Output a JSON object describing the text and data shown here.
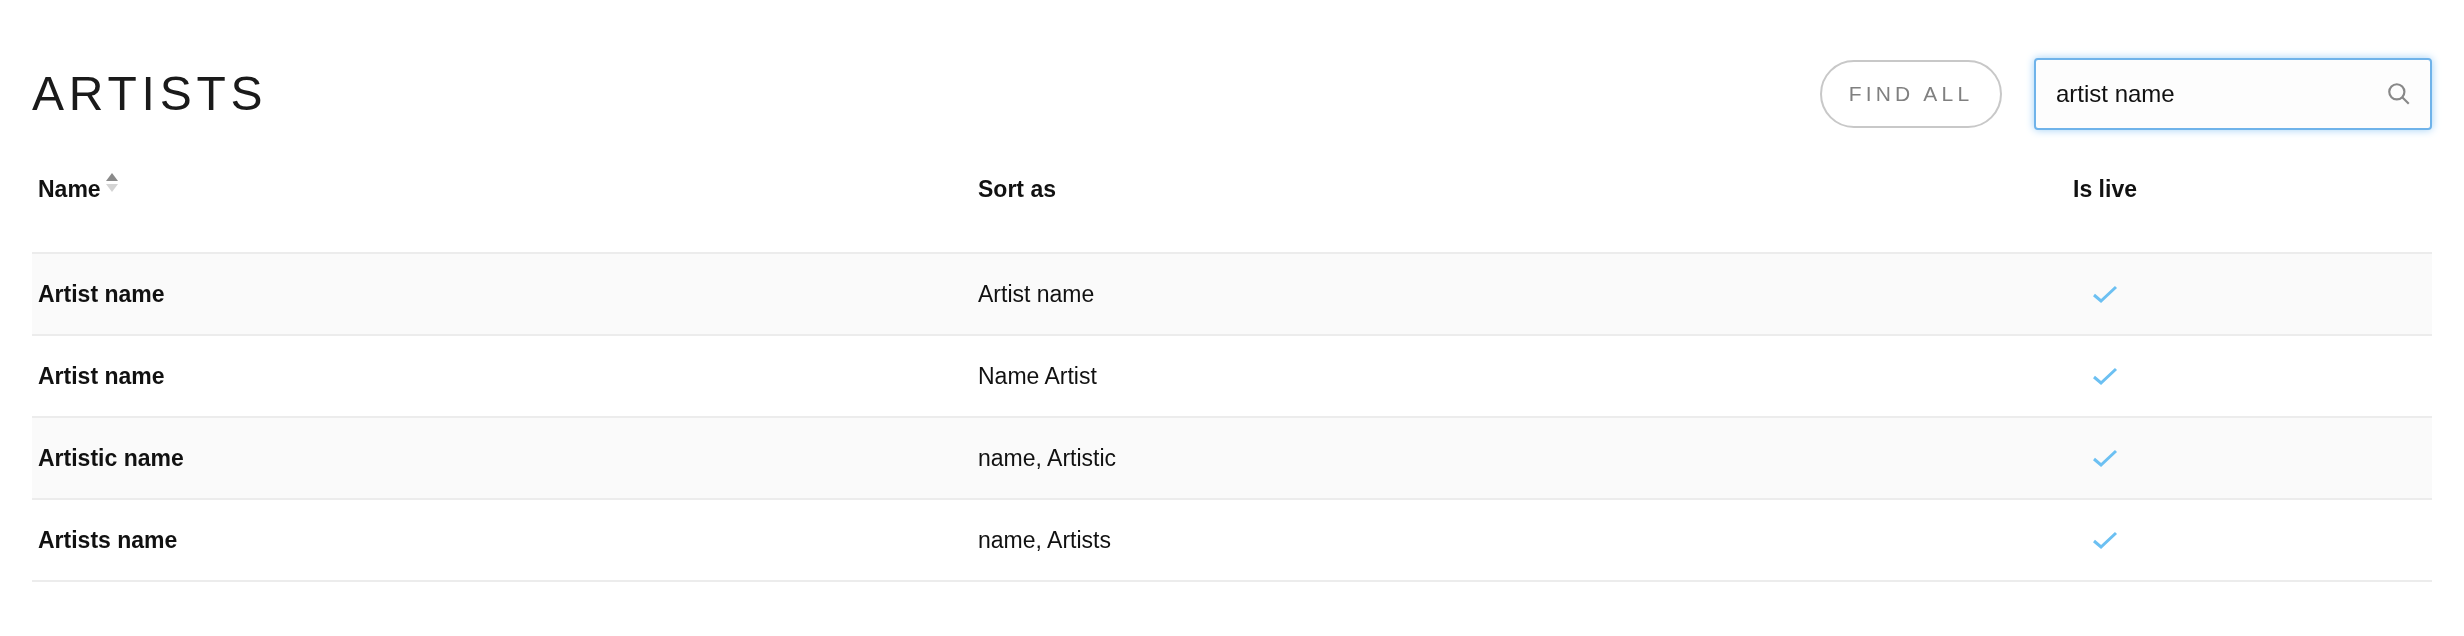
{
  "title": "ARTISTS",
  "find_all_button": "FIND ALL",
  "search": {
    "value": "artist name"
  },
  "table": {
    "columns": [
      {
        "label": "Name",
        "sorted_ascending": true
      },
      {
        "label": "Sort as"
      },
      {
        "label": "Is live"
      }
    ],
    "rows": [
      {
        "name": "Artist name",
        "sort_as": "Artist name",
        "live": true
      },
      {
        "name": "Artist name",
        "sort_as": "Name Artist",
        "live": true
      },
      {
        "name": "Artistic name",
        "sort_as": "name, Artistic",
        "live": true
      },
      {
        "name": "Artists name",
        "sort_as": "name, Artists",
        "live": true
      }
    ]
  }
}
